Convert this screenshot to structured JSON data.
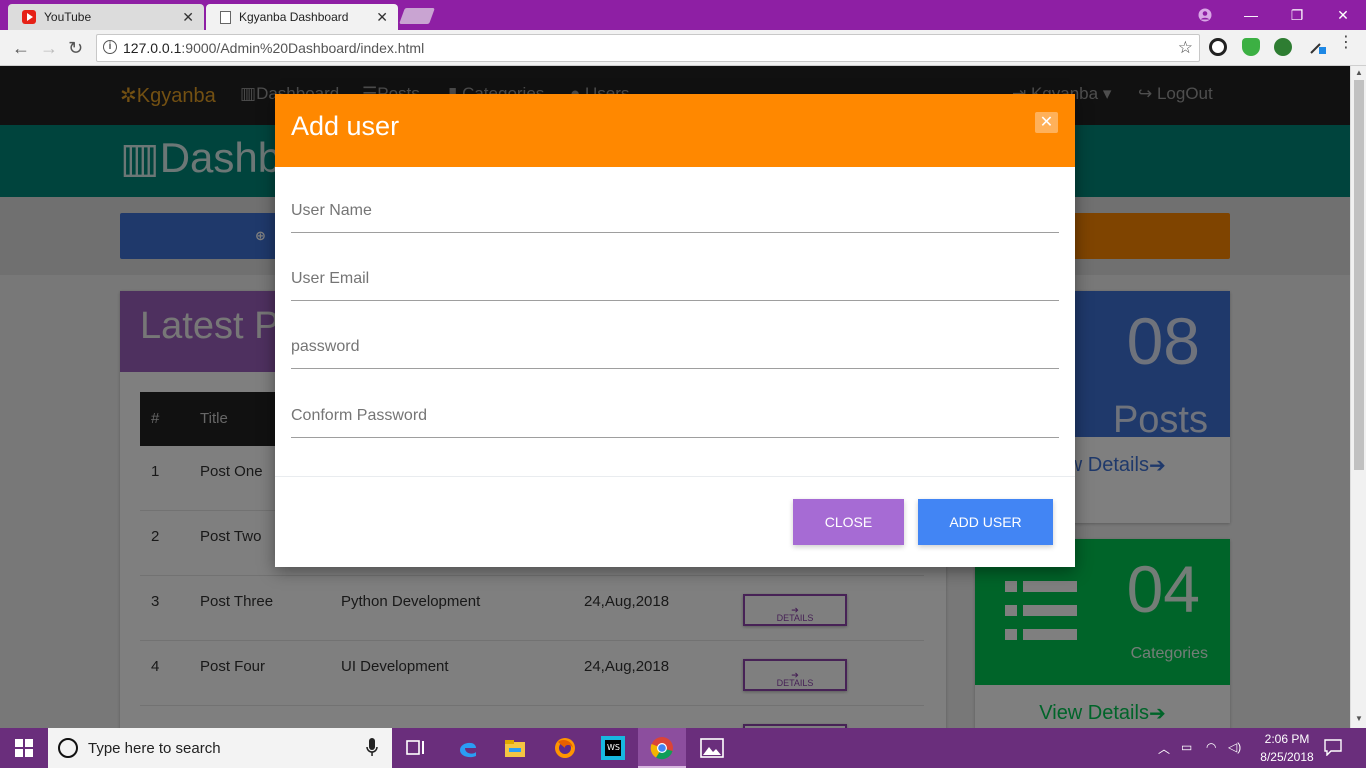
{
  "browser": {
    "tabs": [
      {
        "title": "YouTube",
        "icon": "youtube-icon",
        "active": false
      },
      {
        "title": "Kgyanba Dashboard",
        "icon": "page-icon",
        "active": true
      }
    ],
    "url_host": "127.0.0.1",
    "url_path": ":9000/Admin%20Dashboard/index.html"
  },
  "site": {
    "brand": "Kgyanba",
    "nav": [
      "Dashboard",
      "Posts",
      "Categories",
      "Users"
    ],
    "account": "Kgyanba",
    "logout": "LogOut",
    "header_title": "Dashboard",
    "latest_title": "Latest Posts",
    "table_headers": [
      "#",
      "Title"
    ],
    "rows": [
      {
        "num": "1",
        "title": "Post One",
        "category": "",
        "date": ""
      },
      {
        "num": "2",
        "title": "Post Two",
        "category": "",
        "date": ""
      },
      {
        "num": "3",
        "title": "Post Three",
        "category": "Python Development",
        "date": "24,Aug,2018"
      },
      {
        "num": "4",
        "title": "Post Four",
        "category": "UI Development",
        "date": "24,Aug,2018"
      }
    ],
    "details_label": "DETAILS",
    "posts_count": "08",
    "posts_label": "Posts",
    "categories_count": "04",
    "categories_label": "Categories",
    "view_details": "View Details"
  },
  "modal": {
    "title": "Add user",
    "fields": {
      "username_placeholder": "User Name",
      "email_placeholder": "User Email",
      "password_placeholder": "password",
      "confirm_placeholder": "Conform Password"
    },
    "close_label": "CLOSE",
    "add_label": "ADD USER"
  },
  "taskbar": {
    "search_placeholder": "Type here to search",
    "time": "2:06 PM",
    "date": "8/25/2018"
  },
  "colors": {
    "modal_header": "#ff8800",
    "close_button": "#a66bd4",
    "add_button": "#4285f4",
    "posts_panel": "#3f72d6",
    "categories_panel": "#00c853",
    "teal_band": "#00897b"
  }
}
